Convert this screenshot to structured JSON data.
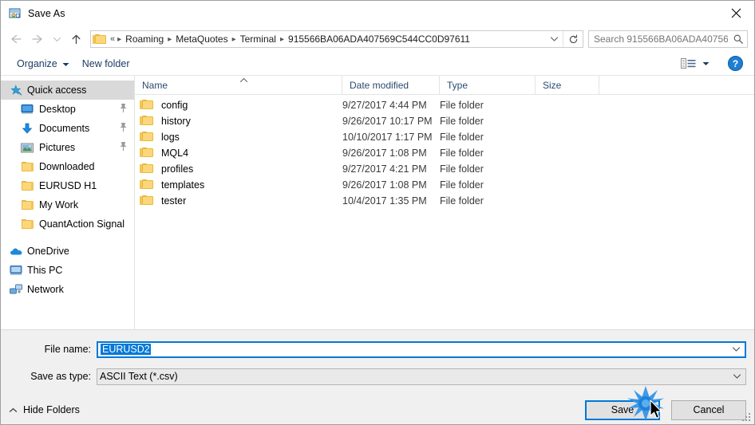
{
  "window": {
    "title": "Save As",
    "icon": "save-as-icon",
    "close_label": "✕"
  },
  "nav": {
    "back": "back-arrow-icon",
    "forward": "forward-arrow-icon",
    "recent": "recent-locations-chevron-icon",
    "up": "up-arrow-icon",
    "address": {
      "folder_icon": "folder-icon",
      "overflow": "«",
      "crumbs": [
        "Roaming",
        "MetaQuotes",
        "Terminal",
        "915566BA06ADA407569C544CC0D97611"
      ],
      "dropdown_icon": "chevron-down-icon",
      "refresh_icon": "refresh-icon"
    },
    "search": {
      "placeholder": "Search 915566BA06ADA40756...",
      "value": "",
      "icon": "search-icon"
    }
  },
  "toolbar": {
    "organize_label": "Organize",
    "organize_caret": "caret-down-icon",
    "new_folder_label": "New folder",
    "view_icon": "view-mode-icon",
    "view_caret": "caret-down-icon",
    "help_icon": "help-icon",
    "help_label": "?"
  },
  "sidebar": {
    "items": [
      {
        "label": "Quick access",
        "icon": "star-pin-icon",
        "selected": true,
        "indent": false,
        "pinned": false
      },
      {
        "label": "Desktop",
        "icon": "desktop-icon",
        "selected": false,
        "indent": true,
        "pinned": true
      },
      {
        "label": "Documents",
        "icon": "documents-icon",
        "selected": false,
        "indent": true,
        "pinned": true
      },
      {
        "label": "Pictures",
        "icon": "pictures-icon",
        "selected": false,
        "indent": true,
        "pinned": true
      },
      {
        "label": "Downloaded",
        "icon": "folder-icon",
        "selected": false,
        "indent": true,
        "pinned": false
      },
      {
        "label": "EURUSD H1",
        "icon": "folder-icon",
        "selected": false,
        "indent": true,
        "pinned": false
      },
      {
        "label": "My Work",
        "icon": "folder-icon",
        "selected": false,
        "indent": true,
        "pinned": false
      },
      {
        "label": "QuantAction Signal",
        "icon": "folder-icon",
        "selected": false,
        "indent": true,
        "pinned": false
      }
    ],
    "roots": [
      {
        "label": "OneDrive",
        "icon": "onedrive-cloud-icon"
      },
      {
        "label": "This PC",
        "icon": "this-pc-icon"
      },
      {
        "label": "Network",
        "icon": "network-icon"
      }
    ]
  },
  "filelist": {
    "columns": [
      "Name",
      "Date modified",
      "Type",
      "Size"
    ],
    "sort_column": "Name",
    "sort_direction": "ascending",
    "rows": [
      {
        "name": "config",
        "date": "9/27/2017 4:44 PM",
        "type": "File folder",
        "size": ""
      },
      {
        "name": "history",
        "date": "9/26/2017 10:17 PM",
        "type": "File folder",
        "size": ""
      },
      {
        "name": "logs",
        "date": "10/10/2017 1:17 PM",
        "type": "File folder",
        "size": ""
      },
      {
        "name": "MQL4",
        "date": "9/26/2017 1:08 PM",
        "type": "File folder",
        "size": ""
      },
      {
        "name": "profiles",
        "date": "9/27/2017 4:21 PM",
        "type": "File folder",
        "size": ""
      },
      {
        "name": "templates",
        "date": "9/26/2017 1:08 PM",
        "type": "File folder",
        "size": ""
      },
      {
        "name": "tester",
        "date": "10/4/2017 1:35 PM",
        "type": "File folder",
        "size": ""
      }
    ]
  },
  "footer": {
    "filename_label": "File name:",
    "filename_value": "EURUSD2",
    "filename_selected": true,
    "savetype_label": "Save as type:",
    "savetype_value": "ASCII Text (*.csv)",
    "hide_folders_label": "Hide Folders",
    "hide_folders_caret": "caret-up-icon",
    "save_label": "Save",
    "cancel_label": "Cancel"
  },
  "colors": {
    "accent": "#0078d7",
    "folder_yellow": "#fcd77a",
    "selection_bg": "#d9d9d9",
    "header_text": "#2b4a6f",
    "chrome_bg": "#f0f0f0"
  }
}
